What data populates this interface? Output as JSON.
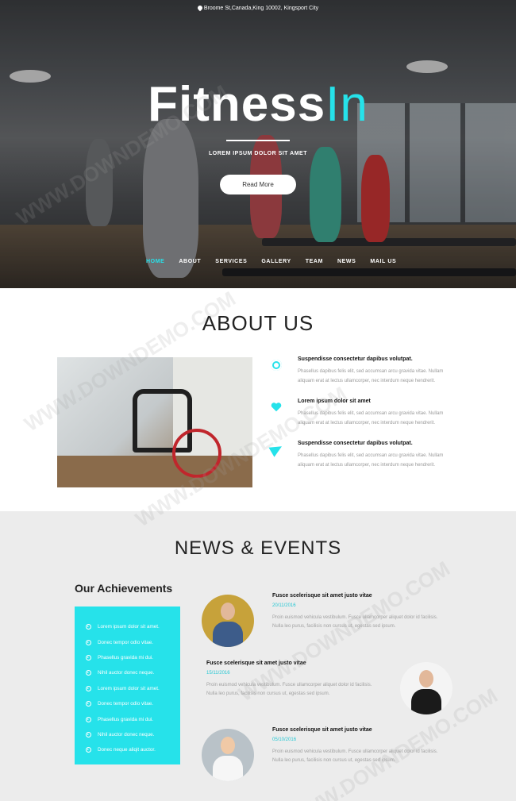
{
  "header": {
    "address": "Broome St,Canada,King 10002, Kingsport City",
    "brand_primary": "Fitness",
    "brand_accent": "In",
    "tagline": "LOREM IPSUM DOLOR SIT AMET",
    "cta_label": "Read More",
    "nav": [
      {
        "label": "HOME",
        "active": true
      },
      {
        "label": "ABOUT",
        "active": false
      },
      {
        "label": "SERVICES",
        "active": false
      },
      {
        "label": "GALLERY",
        "active": false
      },
      {
        "label": "TEAM",
        "active": false
      },
      {
        "label": "NEWS",
        "active": false
      },
      {
        "label": "MAIL US",
        "active": false
      }
    ]
  },
  "about": {
    "title": "ABOUT US",
    "features": [
      {
        "icon": "gear-icon",
        "title": "Suspendisse consectetur dapibus volutpat.",
        "line1": "Phasellus dapibus felis elit, sed accumsan arcu gravida vitae. Nullam",
        "line2": "aliquam erat at lectus ullamcorper, nec interdum neque hendrerit."
      },
      {
        "icon": "heart-icon",
        "title": "Lorem ipsum dolor sit amet",
        "line1": "Phasellus dapibus felis elit, sed accumsan arcu gravida vitae. Nullam",
        "line2": "aliquam erat at lectus ullamcorper, nec interdum neque hendrerit."
      },
      {
        "icon": "paper-plane-icon",
        "title": "Suspendisse consectetur dapibus volutpat.",
        "line1": "Phasellus dapibus felis elit, sed accumsan arcu gravida vitae. Nullam",
        "line2": "aliquam erat at lectus ullamcorper, nec interdum neque hendrerit."
      }
    ]
  },
  "news": {
    "title": "NEWS & EVENTS",
    "achievements_title": "Our Achievements",
    "achievements": [
      "Lorem ipsum dolor sit amet.",
      "Donec tempor odio vitae.",
      "Phasellus gravida mi dui.",
      "Nihil auctor donec neque.",
      "Lorem ipsum dolor sit amet.",
      "Donec tempor odio vitae.",
      "Phasellus gravida mi dui.",
      "Nihil auctor donec neque.",
      "Donec neque aliqit auctor."
    ],
    "events": [
      {
        "title": "Fusce scelerisque sit amet justo vitae",
        "date": "20/11/2016",
        "line1": "Proin euismod vehicula vestibulum. Fusce ullamcorper aliquet dolor id facilisis.",
        "line2": "Nulla leo purus, facilisis non cursus ut, egestas sed ipsum."
      },
      {
        "title": "Fusce scelerisque sit amet justo vitae",
        "date": "15/11/2016",
        "line1": "Proin euismod vehicula vestibulum. Fusce ullamcorper aliquet dolor id facilisis.",
        "line2": "Nulla leo purus, facilisis non cursus ut, egestas sed ipsum."
      },
      {
        "title": "Fusce scelerisque sit amet justo vitae",
        "date": "05/10/2016",
        "line1": "Proin euismod vehicula vestibulum. Fusce ullamcorper aliquet dolor id facilisis.",
        "line2": "Nulla leo purus, facilisis non cursus ut, egestas sed ipsum."
      }
    ]
  },
  "watermark": "WWW.DOWNDEMO.COM",
  "colors": {
    "accent": "#26e2ea",
    "date": "#26c8d4",
    "news_bg": "#ececec"
  }
}
